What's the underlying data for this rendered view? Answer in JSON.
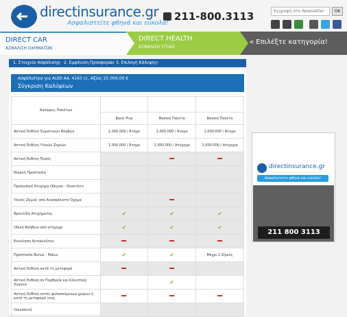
{
  "header": {
    "logo_name": "directinsurance.gr",
    "logo_tagline": "Ασφαλιστείτε φθηνά και εύκολα!",
    "phone": "211-800.3113",
    "newsletter_placeholder": "Εγγραφή στο Newsletter",
    "newsletter_button": "OK",
    "social_icons": [
      "video-icon",
      "mail-icon",
      "rss-icon",
      "sms-icon",
      "twitter-icon",
      "facebook-icon"
    ]
  },
  "nav": {
    "car_title": "DIRECT CAR",
    "car_sub": "ΑΣΦΑΛΙΣΗ ΟΧΗΜΑΤΩΝ",
    "health_title": "DIRECT HEALTH",
    "health_sub": "ΑΣΦΑΛΙΣΗ ΥΓΕΙΑΣ",
    "category_label": "« Επιλέξτε κατηγορία!"
  },
  "steps": [
    "1. Στοιχεία Ασφάλισης",
    "2. Εμφάνιση Προσφορών",
    "3. Επιλογή Κάλυψης"
  ],
  "panel": {
    "subtitle": "Ασφάλιστρα για AUDI A4, 4163 cc, Αξίας 25.000,00 €",
    "title": "Σύγκριση Καλύψεων"
  },
  "table": {
    "header_label": "Καλύψεις Πακέτων",
    "packages": [
      "Basic Plus",
      "Βασικό Πακέτο",
      "Βασικό Πακέτο"
    ],
    "rows": [
      {
        "name": "Αστική Ευθύνη Σωματικών Βλαβών",
        "values": [
          "1.000.000 / Άτομο",
          "1.000.000 / Άτομο",
          "1.000.000 / Άτομο"
        ]
      },
      {
        "name": "Αστική Ευθύνη Υλικών Ζημιών",
        "values": [
          "1.000.000 / Άτομο",
          "1.000.000 / Ατύχημα",
          "1.000.000 / Ατύχημα"
        ]
      },
      {
        "name": "Αστική Ευθύνη Πυρός",
        "values": [
          "",
          "dash",
          "dash"
        ]
      },
      {
        "name": "Νομική Προστασία",
        "values": [
          "",
          "",
          ""
        ]
      },
      {
        "name": "Προσωπικό Ατύχημα Οδηγού - Ιδιοκτήτη",
        "values": [
          "",
          "",
          ""
        ]
      },
      {
        "name": "Υλικές Ζημιές από Ανασφάλιστο Όχημα",
        "values": [
          "",
          "dash",
          ""
        ]
      },
      {
        "name": "Φροντίδα Ατυχήματος",
        "values": [
          "tick",
          "tick",
          "tick"
        ]
      },
      {
        "name": "Οδική Βοήθεια από ατύχημα",
        "values": [
          "tick",
          "tick",
          "tick"
        ]
      },
      {
        "name": "Ενοικίαση Αυτοκινήτου",
        "values": [
          "dash",
          "dash",
          "dash"
        ]
      },
      {
        "name": "Προστασία Bonus - Malus",
        "values": [
          "tick",
          "tick",
          "Μέχρι 2 Ζημιές"
        ]
      },
      {
        "name": "Αστική Ευθύνη κατά τη μεταφορά",
        "values": [
          "dash",
          "dash",
          ""
        ]
      },
      {
        "name": "Αστική Ευθύνη σε Πορθμεία και Κλειστούς Χώρους",
        "values": [
          "",
          "tick",
          ""
        ]
      },
      {
        "name": "Αστική Ευθύνη εκτός φυλασσόμενων χώρων ή κατά τη μεταφορά τους",
        "values": [
          "dash",
          "dash",
          "dash"
        ]
      },
      {
        "name": "Οικοσκευή",
        "values": [
          "",
          "",
          ""
        ]
      }
    ]
  },
  "ad": {
    "logo_name": "directinsurance.gr",
    "slogan": "Ασφαλιστείτε φθηνά και εύκολα!",
    "phone": "211 800 3113"
  },
  "colors": {
    "brand_blue": "#1a5fa6",
    "brand_light_blue": "#2a9be0",
    "health_green": "#9ccc44",
    "tick_green": "#7cb342",
    "dash_red": "#c82b2b"
  }
}
